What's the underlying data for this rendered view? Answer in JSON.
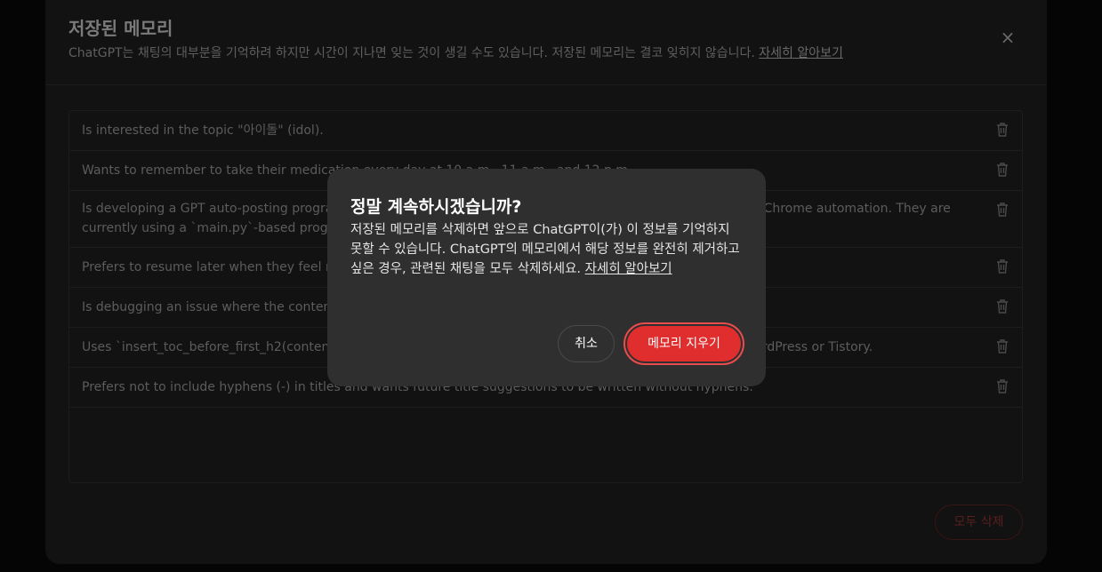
{
  "panel": {
    "title": "저장된 메모리",
    "description": "ChatGPT는 채팅의 대부분을 기억하려 하지만 시간이 지나면 잊는 것이 생길 수도 있습니다. 저장된 메모리는 결코 잊히지 않습니다. ",
    "learn_more": "자세히 알아보기",
    "close_icon": "×",
    "clear_all_label": "모두 삭제"
  },
  "memories": [
    {
      "text": "Is interested in the topic \"아이돌\" (idol)."
    },
    {
      "text": "Wants to remember to take their medication every day at 10 a.m., 11 a.m., and 12 p.m."
    },
    {
      "text": "Is developing a GPT auto-posting program and is adding multiple blog accounts for automated posting using Chrome automation. They are currently using a `main.py`-based program."
    },
    {
      "text": "Prefers to resume later when they feel ready."
    },
    {
      "text": "Is debugging an issue where the content is not displayed properly after saving."
    },
    {
      "text": "Uses `insert_toc_before_first_h2(content)` to add a table of contents before the first H2 before posting to WordPress or Tistory."
    },
    {
      "text": "Prefers not to include hyphens (-) in titles and wants future title suggestions to be written without hyphens."
    }
  ],
  "dialog": {
    "title": "정말 계속하시겠습니까?",
    "body": "저장된 메모리를 삭제하면 앞으로 ChatGPT이(가) 이 정보를 기억하지 못할 수 있습니다. ChatGPT의 메모리에서 해당 정보를 완전히 제거하고 싶은 경우, 관련된 채팅을 모두 삭제하세요. ",
    "learn_more": "자세히 알아보기",
    "cancel_label": "취소",
    "confirm_label": "메모리 지우기"
  },
  "colors": {
    "danger": "#e02e2e",
    "dialog_bg": "#2f2f2f"
  },
  "icons": {
    "delete": "trash-icon",
    "close": "close-icon"
  }
}
